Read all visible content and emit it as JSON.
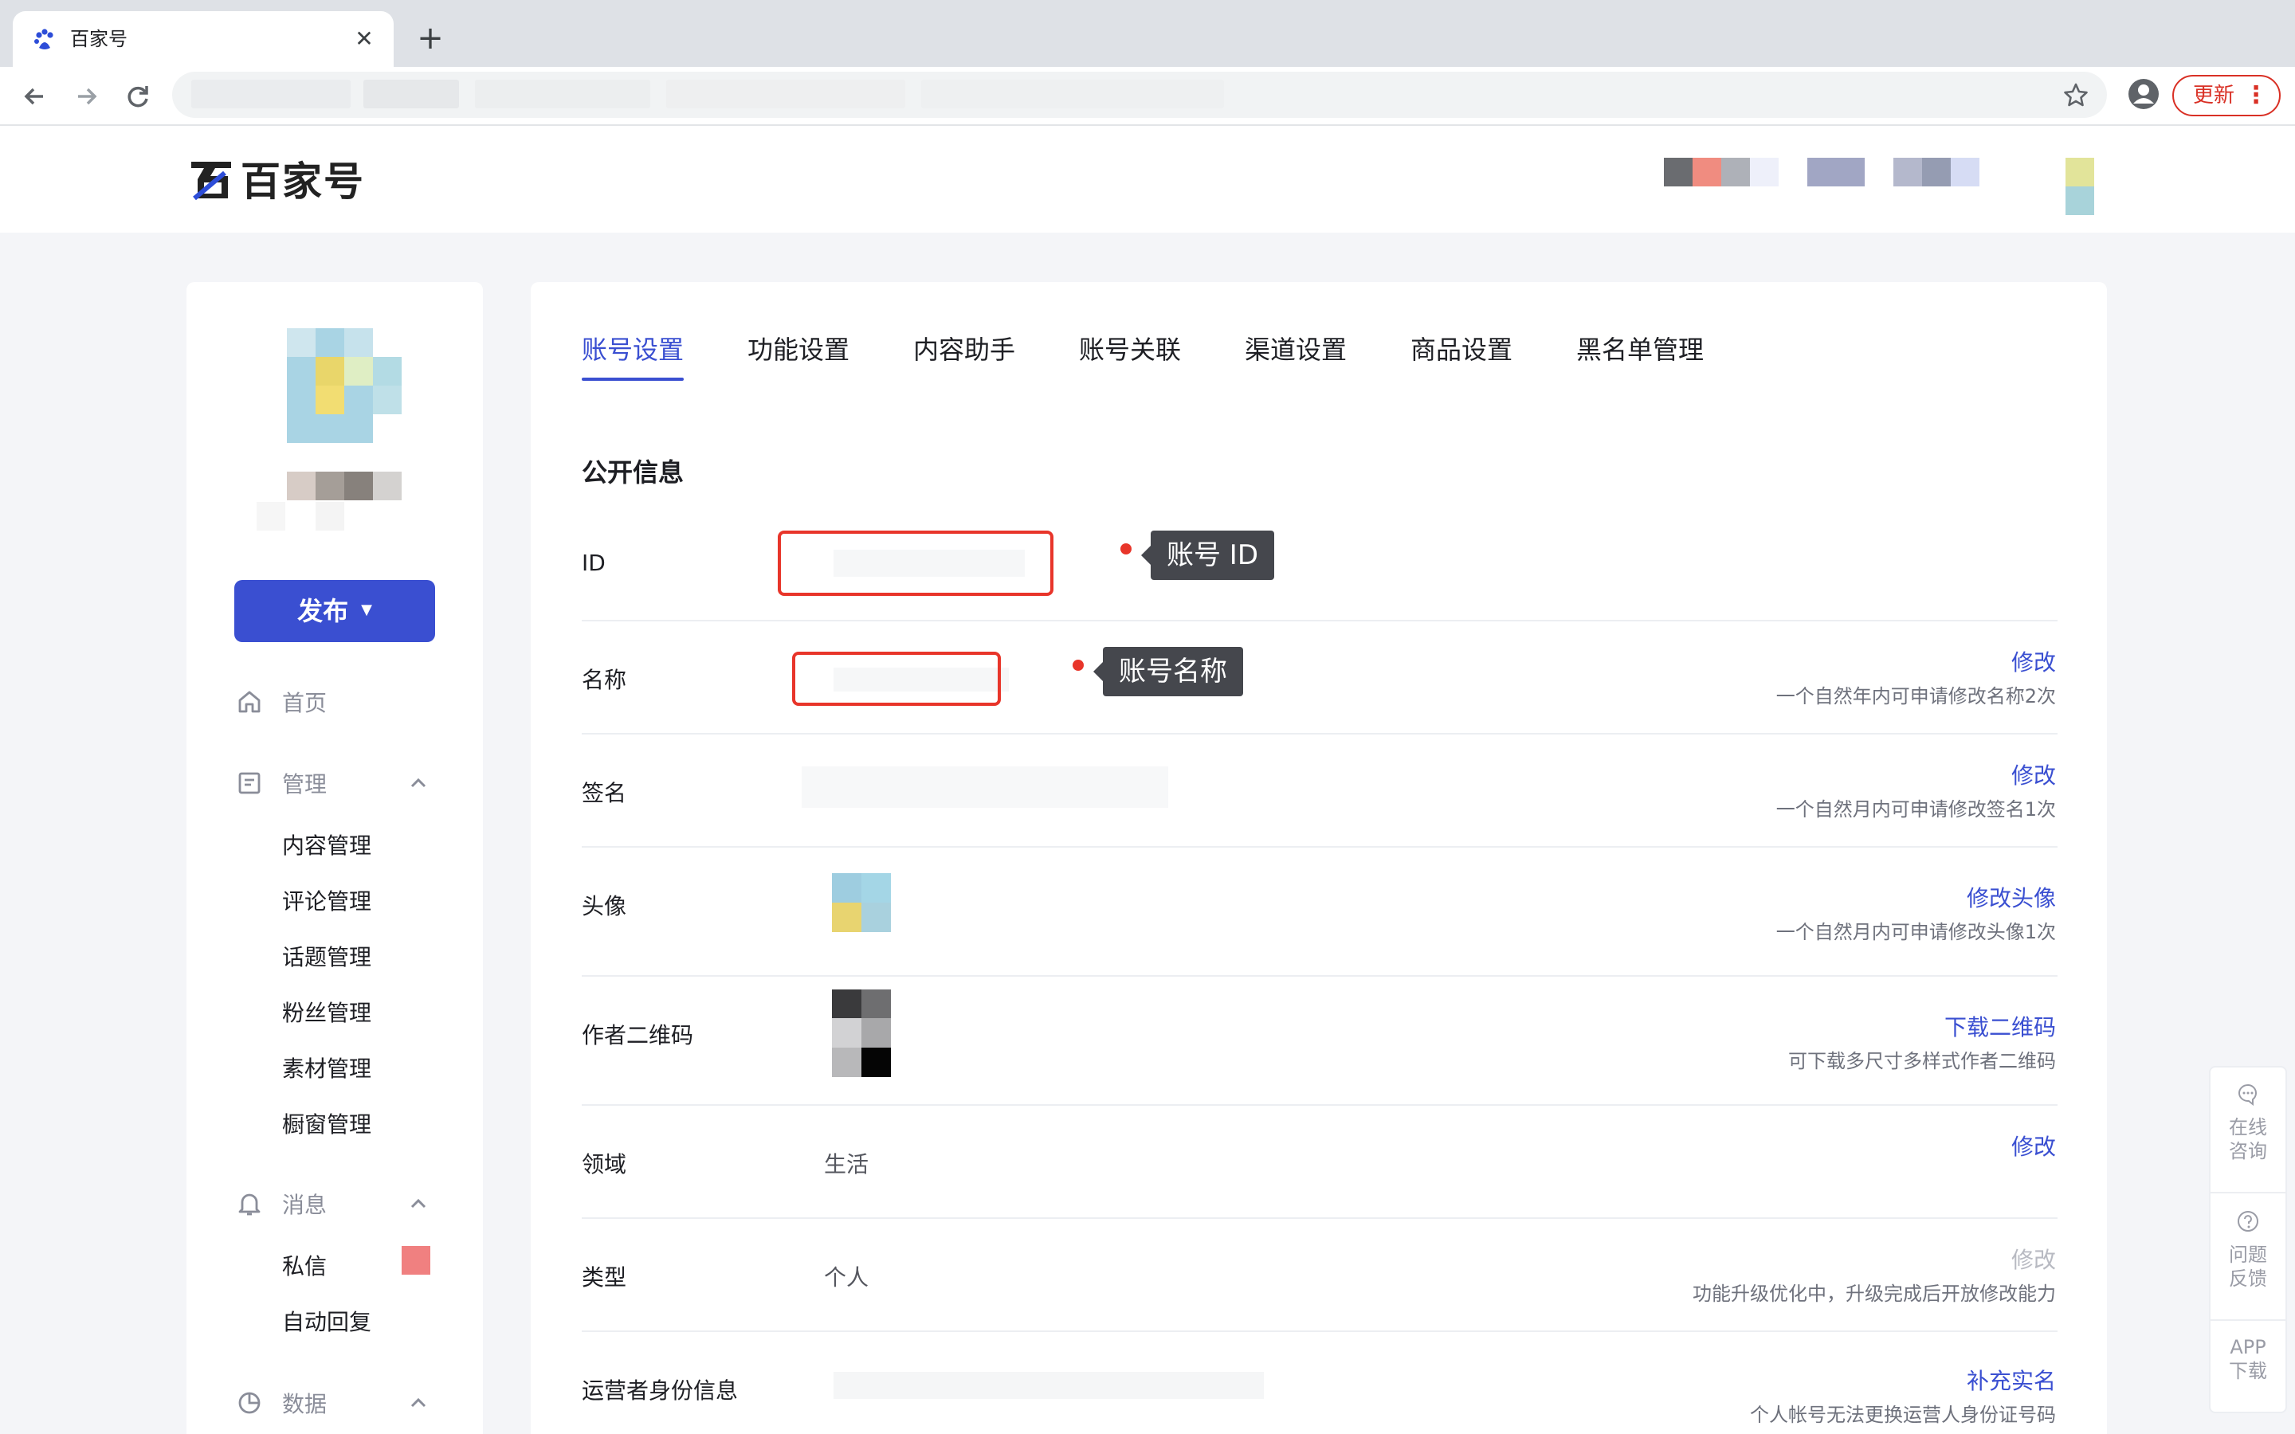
{
  "browser": {
    "tab_title": "百家号",
    "update_label": "更新"
  },
  "site": {
    "logo_text": "百家号"
  },
  "sidebar": {
    "publish_label": "发布",
    "home_label": "首页",
    "manage_label": "管理",
    "manage_items": [
      "内容管理",
      "评论管理",
      "话题管理",
      "粉丝管理",
      "素材管理",
      "橱窗管理"
    ],
    "message_label": "消息",
    "message_items": [
      "私信",
      "自动回复"
    ],
    "data_label": "数据"
  },
  "tabs": [
    "账号设置",
    "功能设置",
    "内容助手",
    "账号关联",
    "渠道设置",
    "商品设置",
    "黑名单管理"
  ],
  "active_tab": "账号设置",
  "section_title": "公开信息",
  "rows": {
    "id": {
      "label": "ID"
    },
    "name": {
      "label": "名称",
      "action": "修改",
      "hint": "一个自然年内可申请修改名称2次"
    },
    "signature": {
      "label": "签名",
      "action": "修改",
      "hint": "一个自然月内可申请修改签名1次"
    },
    "avatar": {
      "label": "头像",
      "action": "修改头像",
      "hint": "一个自然月内可申请修改头像1次"
    },
    "qrcode": {
      "label": "作者二维码",
      "action": "下载二维码",
      "hint": "可下载多尺寸多样式作者二维码"
    },
    "domain": {
      "label": "领域",
      "value": "生活",
      "action": "修改"
    },
    "type": {
      "label": "类型",
      "value": "个人",
      "action": "修改",
      "hint": "功能升级优化中，升级完成后开放修改能力"
    },
    "operator": {
      "label": "运营者身份信息",
      "action": "补充实名",
      "hint": "个人帐号无法更换运营人身份证号码"
    }
  },
  "annotations": {
    "id_tip": "账号 ID",
    "name_tip": "账号名称"
  },
  "float_panel": {
    "consult": "在线咨询",
    "feedback": "问题反馈",
    "app": "APP下载"
  },
  "colors": {
    "accent": "#3a4fd1",
    "annotation_red": "#e8352a",
    "badge": "#f08080"
  }
}
